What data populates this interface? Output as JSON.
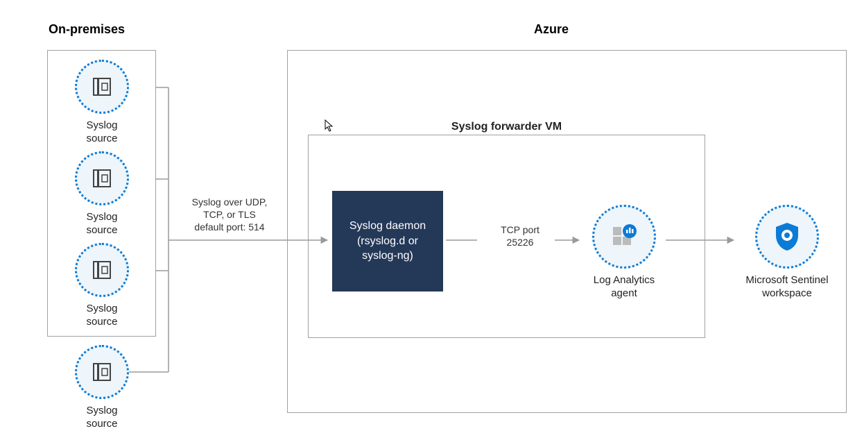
{
  "titles": {
    "onprem": "On-premises",
    "azure": "Azure"
  },
  "syslog_sources": [
    {
      "label": "Syslog source"
    },
    {
      "label": "Syslog source"
    },
    {
      "label": "Syslog source"
    },
    {
      "label": "Syslog source"
    }
  ],
  "conn": {
    "onprem_to_azure": "Syslog over UDP,\nTCP, or TLS\ndefault port: 514",
    "daemon_to_agent": "TCP port\n25226"
  },
  "forwarder": {
    "title": "Syslog forwarder VM",
    "daemon": "Syslog daemon\n(rsyslog.d or\nsyslog-ng)",
    "agent": "Log Analytics\nagent"
  },
  "sentinel": {
    "label": "Microsoft Sentinel\nworkspace"
  },
  "colors": {
    "line": "#9a9a9a",
    "azure_blue": "#0b7bd6",
    "daemon_bg": "#243858"
  }
}
